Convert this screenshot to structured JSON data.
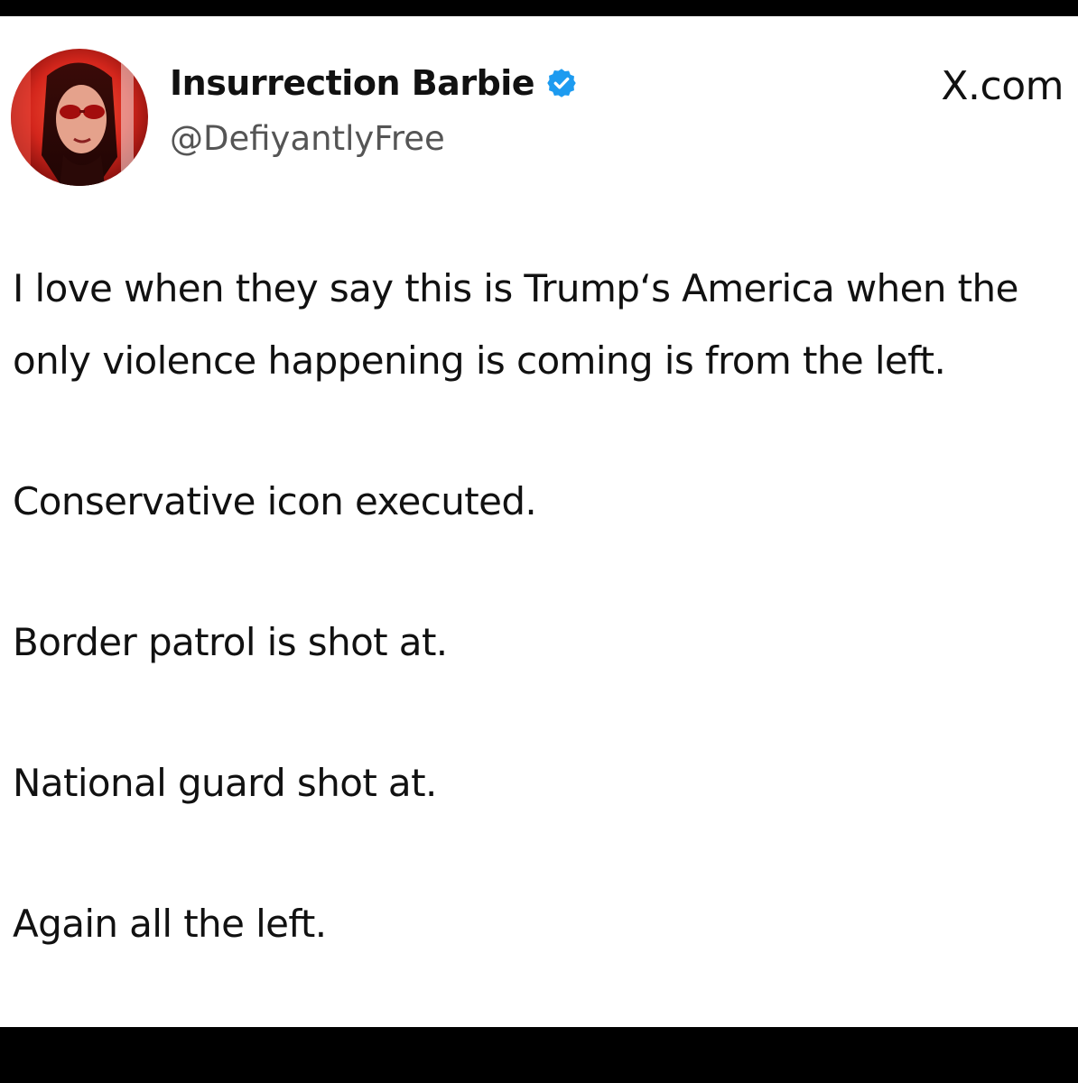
{
  "post": {
    "source": "X.com",
    "author": {
      "display_name": "Insurrection Barbie",
      "handle": "@DefiyantlyFree",
      "verified_icon": "verified-badge-icon",
      "verified_color": "#1d9bf0"
    },
    "paragraphs": [
      "I love when they say this is Trump‘s America when the only violence happening is coming is from the left.",
      "Conservative icon executed.",
      "Border patrol is shot at.",
      "National guard shot at.",
      "Again all the left."
    ]
  },
  "colors": {
    "frame": "#000000",
    "card": "#ffffff",
    "text": "#111111",
    "handle": "#555555"
  }
}
